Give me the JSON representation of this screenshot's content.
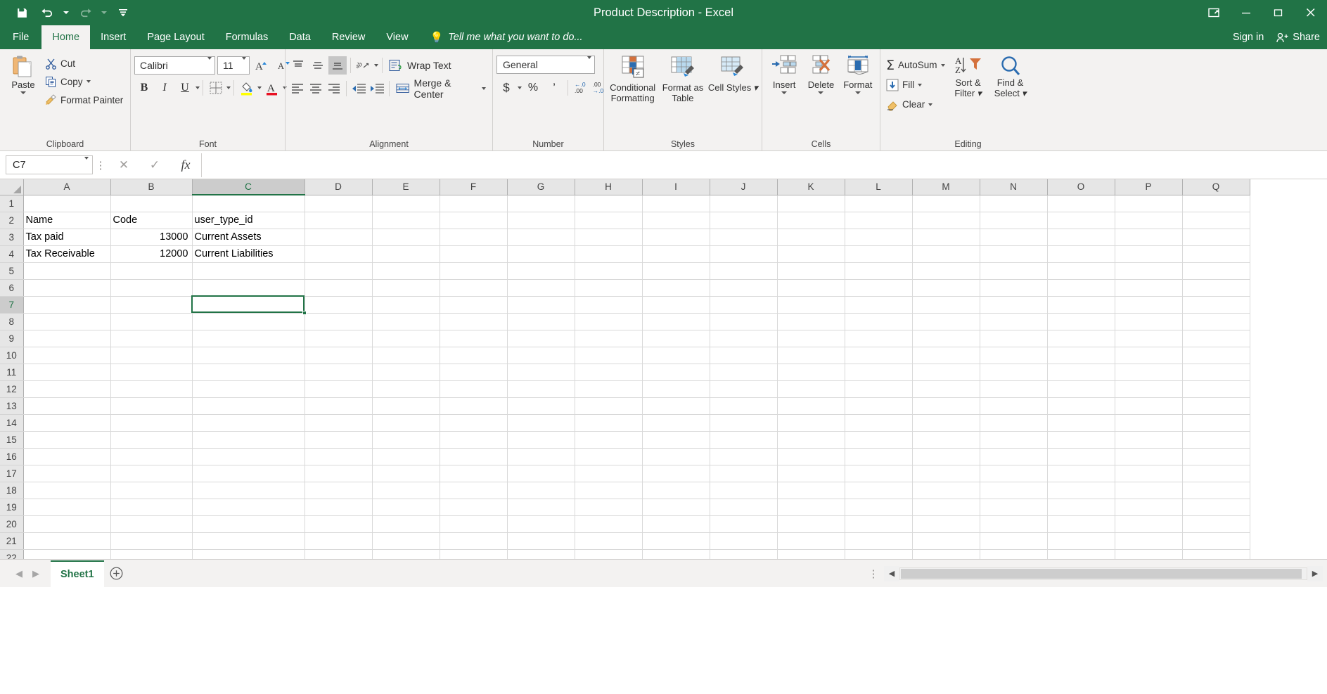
{
  "window": {
    "title": "Product Description - Excel",
    "save_icon": "save-icon",
    "undo_icon": "undo-icon",
    "redo_icon": "redo-icon",
    "customize_icon": "customize-quick-access-icon",
    "ribbon_display_icon": "ribbon-display-options-icon",
    "minimize_icon": "minimize-icon",
    "restore_icon": "restore-icon",
    "close_icon": "close-icon"
  },
  "tabs": [
    {
      "label": "File",
      "active": false
    },
    {
      "label": "Home",
      "active": true
    },
    {
      "label": "Insert",
      "active": false
    },
    {
      "label": "Page Layout",
      "active": false
    },
    {
      "label": "Formulas",
      "active": false
    },
    {
      "label": "Data",
      "active": false
    },
    {
      "label": "Review",
      "active": false
    },
    {
      "label": "View",
      "active": false
    }
  ],
  "tellme": {
    "placeholder": "Tell me what you want to do...",
    "icon": "lightbulb-icon"
  },
  "account": {
    "sign_in": "Sign in",
    "share": "Share",
    "share_icon": "share-person-icon"
  },
  "ribbon": {
    "clipboard": {
      "group_label": "Clipboard",
      "paste": "Paste",
      "cut": "Cut",
      "copy": "Copy",
      "format_painter": "Format Painter",
      "launcher": "↘"
    },
    "font": {
      "group_label": "Font",
      "font_name": "Calibri",
      "font_size": "11",
      "grow_font": "A",
      "shrink_font": "A",
      "bold": "B",
      "italic": "I",
      "underline": "U",
      "borders_icon": "borders-icon",
      "fill_color_icon": "fill-color-icon",
      "font_color_icon": "font-color-icon",
      "launcher": "↘"
    },
    "alignment": {
      "group_label": "Alignment",
      "top_align": "top-align-icon",
      "middle_align": "middle-align-icon",
      "bottom_align": "bottom-align-icon",
      "orientation": "orientation-icon",
      "align_left": "align-left-icon",
      "align_center": "align-center-icon",
      "align_right": "align-right-icon",
      "decrease_indent": "decrease-indent-icon",
      "increase_indent": "increase-indent-icon",
      "wrap_text": "Wrap Text",
      "merge_center": "Merge & Center",
      "launcher": "↘"
    },
    "number": {
      "group_label": "Number",
      "format": "General",
      "accounting": "$",
      "percent": "%",
      "comma": "’",
      "increase_decimal": "increase-decimal-icon",
      "decrease_decimal": "decrease-decimal-icon",
      "launcher": "↘"
    },
    "styles": {
      "group_label": "Styles",
      "conditional_formatting": "Conditional Formatting",
      "format_as_table": "Format as Table",
      "cell_styles": "Cell Styles"
    },
    "cells": {
      "group_label": "Cells",
      "insert": "Insert",
      "delete": "Delete",
      "format": "Format"
    },
    "editing": {
      "group_label": "Editing",
      "autosum": "AutoSum",
      "fill": "Fill",
      "clear": "Clear",
      "sort_filter": "Sort & Filter",
      "find_select": "Find & Select"
    }
  },
  "formula_bar": {
    "name_box": "C7",
    "cancel_icon": "cancel-icon",
    "enter_icon": "enter-check-icon",
    "function_icon": "insert-function-icon",
    "formula_value": ""
  },
  "grid": {
    "columns": [
      "A",
      "B",
      "C",
      "D",
      "E",
      "F",
      "G",
      "H",
      "I",
      "J",
      "K",
      "L",
      "M",
      "N",
      "O",
      "P",
      "Q"
    ],
    "selected_column": "C",
    "selected_cell": "C7",
    "rows": [
      1,
      2,
      3,
      4,
      5,
      6,
      7,
      8,
      9,
      10,
      11,
      12,
      13,
      14,
      15,
      16,
      17,
      18,
      19,
      20,
      21,
      22
    ],
    "data": [
      {
        "row": 2,
        "A": "Name",
        "B": "Code",
        "C": "user_type_id",
        "B_numeric": false
      },
      {
        "row": 3,
        "A": "Tax paid",
        "B": "13000",
        "C": "Current Assets",
        "B_numeric": true
      },
      {
        "row": 4,
        "A": "Tax Receivable",
        "B": "12000",
        "C": "Current Liabilities",
        "B_numeric": true
      }
    ]
  },
  "sheetbar": {
    "prev_icon": "previous-sheet-icon",
    "next_icon": "next-sheet-icon",
    "sheet_name": "Sheet1",
    "add_sheet_icon": "add-sheet-icon",
    "scroll_left_icon": "scroll-left-icon",
    "scroll_right_icon": "scroll-right-icon"
  },
  "colors": {
    "brand_green": "#217346",
    "ribbon_bg": "#f3f2f1",
    "header_bg": "#e6e6e6",
    "selection": "#217346"
  }
}
